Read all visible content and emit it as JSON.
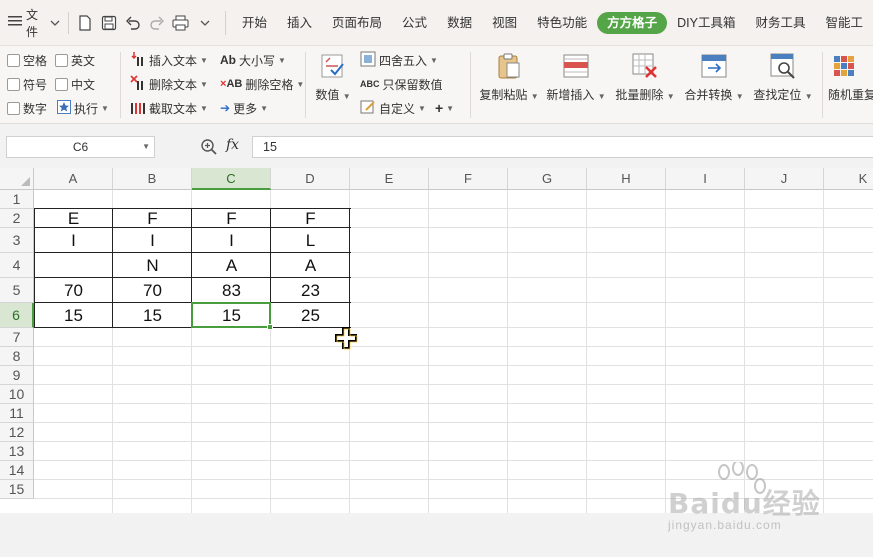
{
  "menubar": {
    "file_label": "文件",
    "tabs": [
      "开始",
      "插入",
      "页面布局",
      "公式",
      "数据",
      "视图",
      "特色功能",
      "方方格子",
      "DIY工具箱",
      "财务工具",
      "智能工"
    ],
    "active_tab": "方方格子"
  },
  "ribbon": {
    "checkboxes": [
      "空格",
      "英文",
      "符号",
      "中文",
      "数字"
    ],
    "execute_label": "执行",
    "text_tools": [
      "插入文本",
      "删除文本",
      "截取文本"
    ],
    "case_tools": [
      "大小写",
      "删除空格",
      "更多"
    ],
    "number_label": "数值",
    "number_tools": [
      "四舍五入",
      "只保留数值",
      "自定义"
    ],
    "big_buttons": [
      "复制粘贴",
      "新增插入",
      "批量删除",
      "合并转换",
      "查找定位",
      "随机重复"
    ]
  },
  "formula_bar": {
    "name_box": "C6",
    "fx_label": "fx",
    "formula": "15"
  },
  "sheet": {
    "columns": [
      "A",
      "B",
      "C",
      "D",
      "E",
      "F",
      "G",
      "H",
      "I",
      "J",
      "K"
    ],
    "rows": [
      "1",
      "2",
      "3",
      "4",
      "5",
      "6",
      "7",
      "8",
      "9",
      "10",
      "11",
      "12",
      "13",
      "14",
      "15"
    ],
    "selected_cell": "C6",
    "cells": {
      "A2": "E",
      "B2": "F",
      "C2": "F",
      "D2": "F",
      "A3": "I",
      "B3": "I",
      "C3": "I",
      "D3": "L",
      "A4": "",
      "B4": "N",
      "C4": "A",
      "D4": "A",
      "A5": "70",
      "B5": "70",
      "C5": "83",
      "D5": "23",
      "A6": "15",
      "B6": "15",
      "C6": "15",
      "D6": "25"
    }
  },
  "watermark": {
    "brand": "Baidu经验",
    "url": "jingyan.baidu.com"
  }
}
